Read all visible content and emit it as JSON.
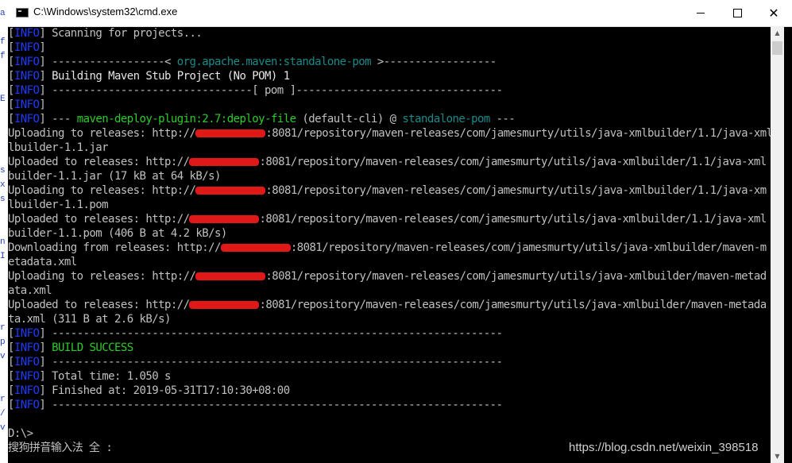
{
  "window": {
    "title": "C:\\Windows\\system32\\cmd.exe",
    "minimize_glyph": "—",
    "maximize_glyph": "☐",
    "close_glyph": "✕",
    "icon": "cmd-icon"
  },
  "background_strip": [
    "a",
    "f",
    "E",
    "s",
    "x",
    "s",
    "n",
    "I",
    "r",
    "p",
    "v",
    "r",
    "/",
    "v"
  ],
  "colors": {
    "console_bg": "#000000",
    "info_tag": "#1c3cff",
    "artifact": "#1a8a8a",
    "success": "#2bcc2b",
    "redaction": "#e01818"
  },
  "console": {
    "tag_open": "[",
    "tag_text": "INFO",
    "tag_close": "]",
    "l1": " Scanning for projects...",
    "l3a": " ------------------< ",
    "l3b": "org.apache.maven:standalone-pom",
    "l3c": " >------------------",
    "l4": " Building Maven Stub Project (No POM) 1",
    "l5": " --------------------------------[ pom ]---------------------------------",
    "l7a": " --- ",
    "l7b": "maven-deploy-plugin:2.7:deploy-file",
    "l7c": " (default-cli) @ ",
    "l7d": "standalone-pom",
    "l7e": " ---",
    "u1a": "Uploading to releases: http://",
    "u1b": ":8081/repository/maven-releases/com/jamesmurty/utils/java-xmlbuilder/1.1/java-xml",
    "u1c": "lbuilder-1.1.jar",
    "u2a": "Uploaded to releases: http://",
    "u2b": ":8081/repository/maven-releases/com/jamesmurty/utils/java-xmlbuilder/1.1/java-xml",
    "u2c": "builder-1.1.jar (17 kB at 64 kB/s)",
    "u3a": "Uploading to releases: http://",
    "u3b": ":8081/repository/maven-releases/com/jamesmurty/utils/java-xmlbuilder/1.1/java-xm",
    "u3c": "lbuilder-1.1.pom",
    "u4a": "Uploaded to releases: http://",
    "u4b": ":8081/repository/maven-releases/com/jamesmurty/utils/java-xmlbuilder/1.1/java-xml",
    "u4c": "builder-1.1.pom (406 B at 4.2 kB/s)",
    "d1a": "Downloading from releases: http://",
    "d1b": ":8081/repository/maven-releases/com/jamesmurty/utils/java-xmlbuilder/maven-m",
    "d1c": "etadata.xml",
    "u5a": "Uploading to releases: http://",
    "u5b": ":8081/repository/maven-releases/com/jamesmurty/utils/java-xmlbuilder/maven-metad",
    "u5c": "ata.xml",
    "u6a": "Uploaded to releases: http://",
    "u6b": ":8081/repository/maven-releases/com/jamesmurty/utils/java-xmlbuilder/maven-metada",
    "u6c": "ta.xml (311 B at 2.6 kB/s)",
    "sep": " ------------------------------------------------------------------------",
    "success": " BUILD SUCCESS",
    "total_time": " Total time: 1.050 s",
    "finished_at": " Finished at: 2019-05-31T17:10:30+08:00",
    "prompt": "D:\\>",
    "ime": "搜狗拼音输入法 全 :"
  },
  "scrollbar": {
    "up_glyph": "▲",
    "down_glyph": "▼"
  },
  "watermark": "https://blog.csdn.net/weixin_398518"
}
